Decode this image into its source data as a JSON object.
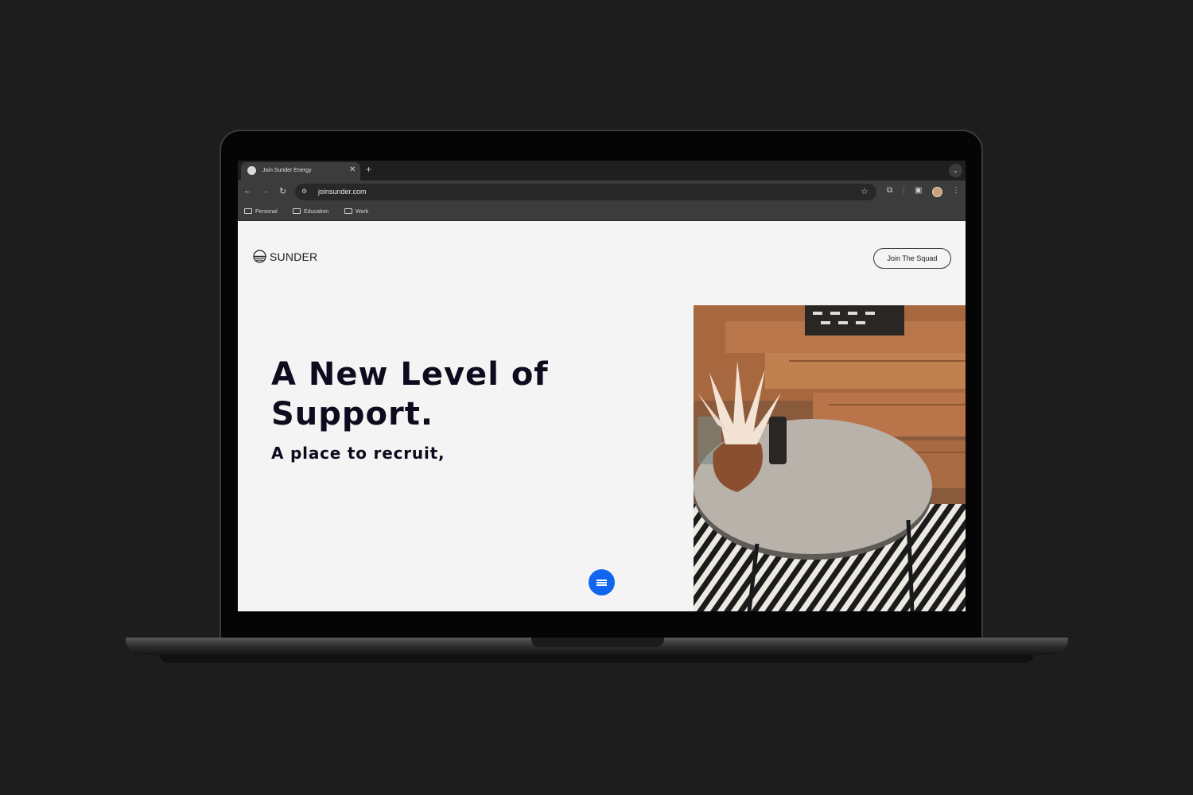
{
  "browser": {
    "tab_title": "Join Sunder Energy",
    "new_tab_label": "+",
    "url": "joinsunder.com",
    "bookmarks": [
      "Personal",
      "Education",
      "Work"
    ]
  },
  "site": {
    "logo_text": "SUNDER",
    "cta_label": "Join The Squad",
    "headline": "A New Level of Support.",
    "subheadline": "A place to recruit,"
  },
  "colors": {
    "accent": "#1066ee",
    "text": "#0c0c1e",
    "page_bg": "#f4f4f4"
  },
  "icons": {
    "tab_close": "close-icon",
    "back": "back-arrow-icon",
    "forward": "forward-arrow-icon",
    "reload": "reload-icon",
    "bookmark": "star-icon",
    "extensions": "puzzle-icon",
    "side_panel": "side-panel-icon",
    "menu": "kebab-menu-icon",
    "chat": "chat-menu-icon"
  }
}
